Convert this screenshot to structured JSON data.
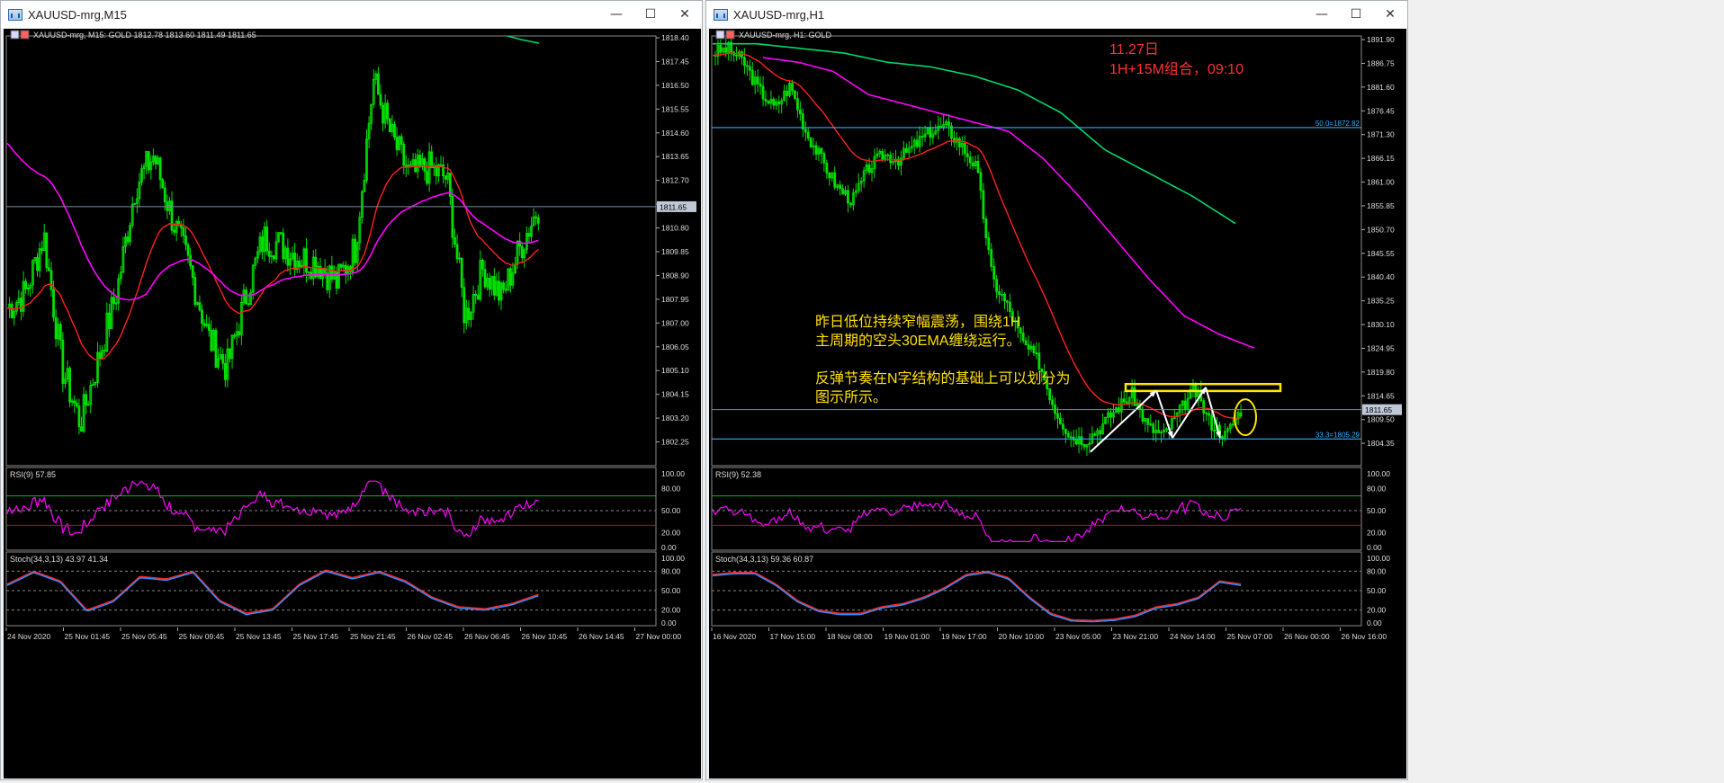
{
  "left": {
    "window_title": "XAUUSD-mrg,M15",
    "header": "XAUUSD-mrg, M15:  GOLD   1812.78  1813.60  1811.49  1811.65",
    "price_ticks": [
      "1818.40",
      "1817.45",
      "1816.50",
      "1815.55",
      "1814.60",
      "1813.65",
      "1812.70",
      "1811.75",
      "1810.80",
      "1809.85",
      "1808.90",
      "1807.95",
      "1807.00",
      "1806.05",
      "1805.10",
      "1804.15",
      "1803.20",
      "1802.25"
    ],
    "price_range": [
      1801.3,
      1818.4
    ],
    "current_price": 1811.65,
    "current_price_label": "1811.65",
    "rsi": {
      "label": "RSI(9) 57.85",
      "value": 57.85,
      "levels": [
        70,
        30
      ]
    },
    "stoch": {
      "label": "Stoch(34,3,13) 43.97 41.34",
      "levels": [
        80,
        20
      ]
    },
    "osc_ticks": [
      "100.00",
      "80.00",
      "50.00",
      "20.00",
      "0.00"
    ],
    "time_ticks": [
      "24 Nov 2020",
      "25 Nov 01:45",
      "25 Nov 05:45",
      "25 Nov 09:45",
      "25 Nov 13:45",
      "25 Nov 17:45",
      "25 Nov 21:45",
      "26 Nov 02:45",
      "26 Nov 06:45",
      "26 Nov 10:45",
      "26 Nov 14:45",
      "27 Nov 00:00"
    ],
    "colors": {
      "candles": "#00e000",
      "ema_fast": "#ff2020",
      "ema_slow": "#ff00ff",
      "ema_long": "#00d86a",
      "rsi_line": "#ff00ff",
      "stoch_main": "#2f8fff",
      "stoch_signal": "#ff2020"
    }
  },
  "right": {
    "window_title": "XAUUSD-mrg,H1",
    "header": "XAUUSD-mrg, H1:  GOLD",
    "price_ticks": [
      "1891.90",
      "1886.75",
      "1881.60",
      "1876.45",
      "1871.30",
      "1866.15",
      "1861.00",
      "1855.85",
      "1850.70",
      "1845.55",
      "1840.40",
      "1835.25",
      "1830.10",
      "1824.95",
      "1819.80",
      "1814.65",
      "1809.50",
      "1804.35"
    ],
    "price_range": [
      1799.5,
      1892.3
    ],
    "current_price": 1811.65,
    "current_price_label": "1811.65",
    "fib_levels": [
      {
        "label": "50.0=1872.82",
        "price": 1872.82
      },
      {
        "label": "33.3=1805.29",
        "price": 1805.29
      }
    ],
    "annotation_red": [
      "11.27日",
      "1H+15M组合，09:10"
    ],
    "annotation_yellow": [
      "昨日低位持续窄幅震荡，围绕1H",
      "主周期的空头30EMA缠绕运行。",
      "",
      "反弹节奏在N字结构的基础上可以划分为",
      "图示所示。"
    ],
    "rsi": {
      "label": "RSI(9) 52.38",
      "value": 52.38,
      "levels": [
        70,
        30
      ]
    },
    "stoch": {
      "label": "Stoch(34,3,13) 59.36 60.87",
      "levels": [
        80,
        20
      ]
    },
    "osc_ticks": [
      "100.00",
      "80.00",
      "50.00",
      "20.00",
      "0.00"
    ],
    "time_ticks": [
      "16 Nov 2020",
      "17 Nov 15:00",
      "18 Nov 08:00",
      "19 Nov 01:00",
      "19 Nov 17:00",
      "20 Nov 10:00",
      "23 Nov 05:00",
      "23 Nov 21:00",
      "24 Nov 14:00",
      "25 Nov 07:00",
      "26 Nov 00:00",
      "26 Nov 16:00"
    ],
    "colors": {
      "annotation_red": "#ff3030",
      "annotation_yellow": "#ffe000",
      "fib_line": "#2bb0ff",
      "drawn_box": "#ffe600",
      "drawn_arrows": "#ffffff"
    }
  },
  "window_buttons": {
    "minimize": "—",
    "maximize": "☐",
    "close": "✕"
  }
}
